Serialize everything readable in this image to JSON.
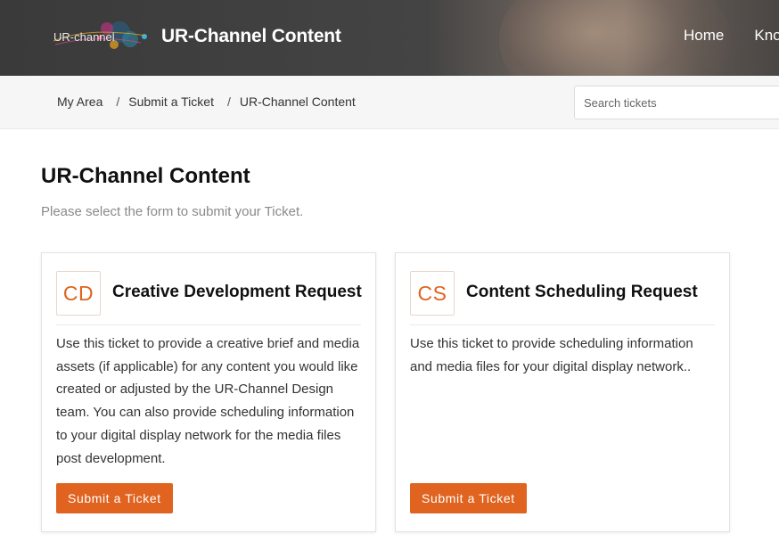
{
  "header": {
    "logo_text": "UR-channel",
    "site_title": "UR-Channel Content",
    "nav": [
      {
        "label": "Home"
      },
      {
        "label": "Knowledge Base"
      }
    ]
  },
  "breadcrumb": {
    "items": [
      "My Area",
      "Submit a Ticket",
      "UR-Channel Content"
    ],
    "separator": "/"
  },
  "search": {
    "placeholder": "Search tickets",
    "value": ""
  },
  "main": {
    "title": "UR-Channel Content",
    "subtitle": "Please select the form to submit your Ticket.",
    "forms": [
      {
        "badge": "CD",
        "title": "Creative Development Request",
        "description": "Use this ticket to provide a creative brief and media assets (if applicable) for any content you would like created or adjusted by the UR-Channel Design team. You can also provide scheduling information to your digital display network for the media files post development.",
        "button_label": "Submit a Ticket"
      },
      {
        "badge": "CS",
        "title": "Content Scheduling Request",
        "description": "Use this ticket to provide scheduling information and media files for your digital display network..",
        "button_label": "Submit a Ticket"
      }
    ]
  },
  "colors": {
    "accent": "#e0631f",
    "header_bg": "#3d3d3d",
    "crumb_bg": "#f6f6f6"
  }
}
